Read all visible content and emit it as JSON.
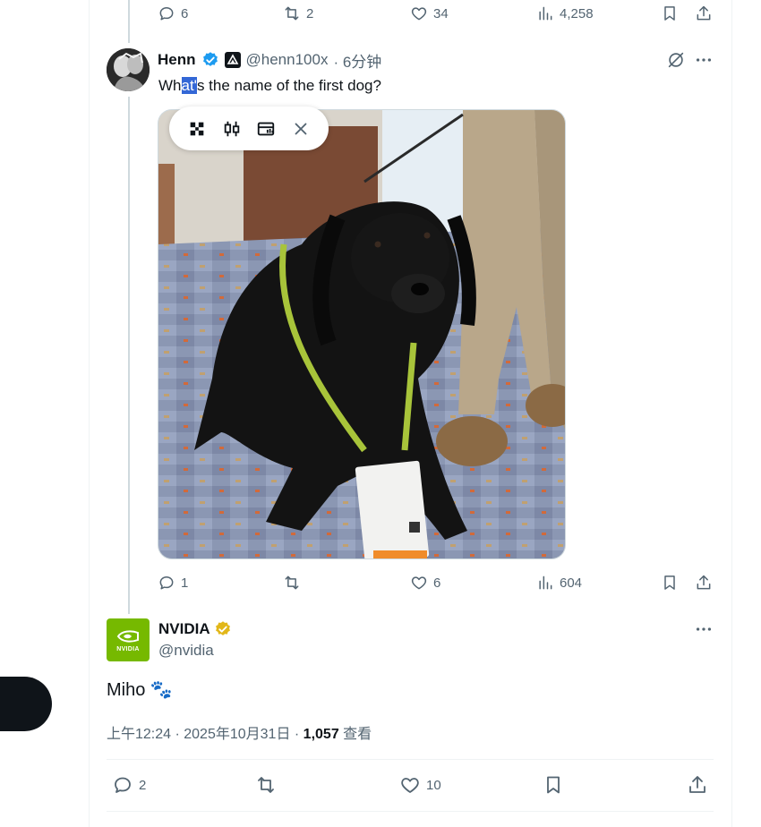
{
  "top_actions": {
    "replies": "6",
    "reposts": "2",
    "likes": "34",
    "views": "4,258"
  },
  "reply": {
    "name": "Henn",
    "handle": "@henn100x",
    "time": "· 6分钟",
    "text_pre": "Wh",
    "text_sel": "at'",
    "text_post": "s the name of the first dog?",
    "actions": {
      "replies": "1",
      "reposts": "",
      "likes": "6",
      "views": "604"
    }
  },
  "main": {
    "name": "NVIDIA",
    "handle": "@nvidia",
    "logo_text": "NVIDIA",
    "text": "Miho 🐾",
    "timestamp": "上午12:24 · 2025年10月31日 · ",
    "views_count": "1,057",
    "views_label": " 查看",
    "actions": {
      "replies": "2",
      "reposts": "",
      "likes": "10"
    }
  },
  "colors": {
    "accent": "#1d9bf0",
    "nvidia_green": "#76b900",
    "gold": "#e2b719",
    "selection": "#3367d6"
  },
  "icons": [
    "reply-icon",
    "repost-icon",
    "like-icon",
    "views-icon",
    "bookmark-icon",
    "share-icon",
    "more-icon",
    "grok-icon",
    "verified-icon"
  ]
}
